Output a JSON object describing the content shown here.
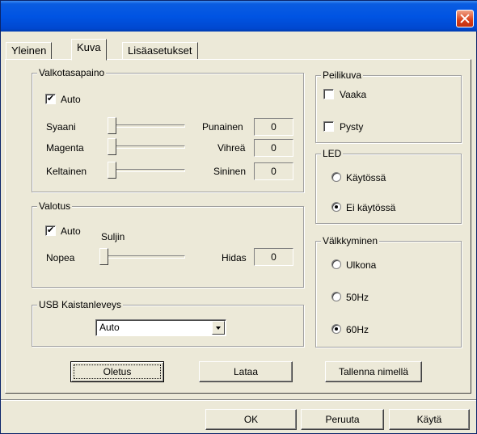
{
  "tabs": [
    "Yleinen",
    "Kuva",
    "Lisäasetukset"
  ],
  "white_balance": {
    "title": "Valkotasapaino",
    "auto_label": "Auto",
    "auto_checked": true,
    "rows": [
      {
        "left": "Syaani",
        "right": "Punainen",
        "value": "0"
      },
      {
        "left": "Magenta",
        "right": "Vihreä",
        "value": "0"
      },
      {
        "left": "Keltainen",
        "right": "Sininen",
        "value": "0"
      }
    ]
  },
  "exposure": {
    "title": "Valotus",
    "auto_label": "Auto",
    "auto_checked": true,
    "shutter_label": "Suljin",
    "left": "Nopea",
    "right": "Hidas",
    "value": "0"
  },
  "usb": {
    "title": "USB Kaistanleveys",
    "selected": "Auto"
  },
  "mirror": {
    "title": "Peilikuva",
    "horizontal": "Vaaka",
    "vertical": "Pysty",
    "horizontal_checked": false,
    "vertical_checked": false
  },
  "led": {
    "title": "LED",
    "options": [
      "Käytössä",
      "Ei käytössä"
    ],
    "selected": "Ei käytössä"
  },
  "flicker": {
    "title": "Välkkyminen",
    "options": [
      "Ulkona",
      "50Hz",
      "60Hz"
    ],
    "selected": "60Hz"
  },
  "buttons": {
    "default": "Oletus",
    "load": "Lataa",
    "save_as": "Tallenna nimellä",
    "ok": "OK",
    "cancel": "Peruuta",
    "apply": "Käytä"
  },
  "colors": {
    "title_bar": "#0054e3",
    "face": "#ece9d8",
    "close": "#d8401a"
  },
  "icons": [
    "close-icon",
    "chevron-down-icon",
    "checkmark-icon"
  ]
}
